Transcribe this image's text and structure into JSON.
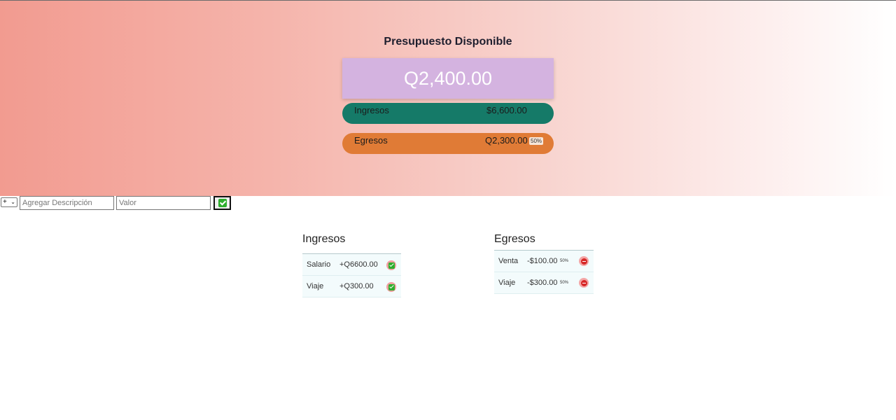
{
  "budget": {
    "title": "Presupuesto Disponible",
    "available": "Q2,400.00"
  },
  "summary": {
    "income_label": "Ingresos",
    "income_value": "$6,600.00",
    "expense_label": "Egresos",
    "expense_value": "Q2,300.00",
    "expense_percent": "50%"
  },
  "form": {
    "type_selected": "+",
    "description_placeholder": "Agregar Descripción",
    "value_placeholder": "Valor"
  },
  "income": {
    "title": "Ingresos",
    "items": [
      {
        "description": "Salario",
        "value": "+Q6600.00"
      },
      {
        "description": "Viaje",
        "value": "+Q300.00"
      }
    ]
  },
  "expenses": {
    "title": "Egresos",
    "items": [
      {
        "description": "Venta",
        "value": "-$100.00",
        "percent": "50%"
      },
      {
        "description": "Viaje",
        "value": "-$300.00",
        "percent": "50%"
      }
    ]
  },
  "colors": {
    "income_pill": "#157a68",
    "expense_pill": "#e07b36",
    "budget_box": "#d4b3e0"
  },
  "icons": {
    "confirm": "check-icon",
    "delete": "remove-icon"
  }
}
